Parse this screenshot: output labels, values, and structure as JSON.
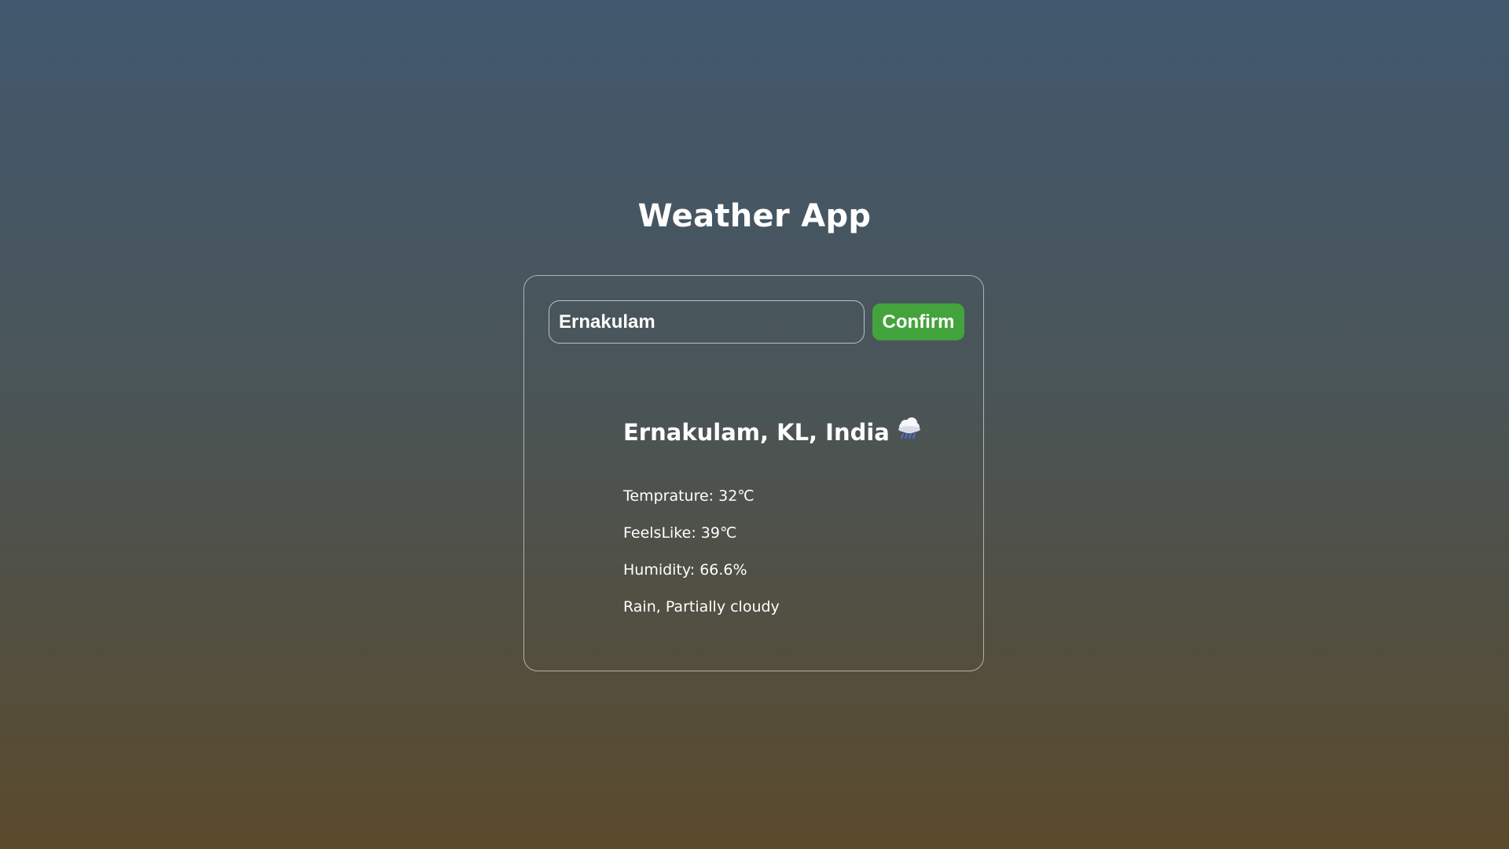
{
  "app": {
    "title": "Weather App"
  },
  "search": {
    "value": "Ernakulam",
    "placeholder": "",
    "confirm_label": "Confirm"
  },
  "weather": {
    "location": "Ernakulam, KL, India",
    "icon": "rain-cloud-icon",
    "temperature": "Temprature: 32℃",
    "feels_like": "FeelsLike: 39℃",
    "humidity": "Humidity: 66.6%",
    "description": "Rain, Partially cloudy"
  },
  "colors": {
    "confirm_button": "#43a33c",
    "background_top": "#41586e",
    "background_bottom": "#5b4a2c"
  }
}
